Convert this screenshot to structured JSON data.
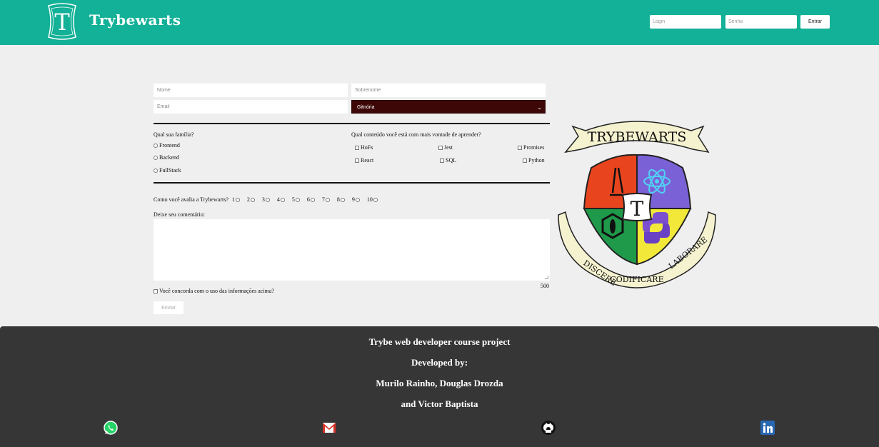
{
  "header": {
    "brand": "Trybewarts",
    "login_placeholder": "Login",
    "password_placeholder": "Senha",
    "login_button": "Entrar",
    "background": "#13b197"
  },
  "form": {
    "name_placeholder": "Nome",
    "lastname_placeholder": "Sobrenome",
    "email_placeholder": "Email",
    "house_selected": "Gitnória",
    "family_question": "Qual sua família?",
    "families": [
      "Frontend",
      "Backend",
      "FullStack"
    ],
    "content_question": "Qual conteúdo você está com mais vontade de aprender?",
    "contents": [
      "HoFs",
      "Jest",
      "Promises",
      "React",
      "SQL",
      "Python"
    ],
    "rating_question": "Como você avalia a Trybewarts?",
    "ratings": [
      "1",
      "2",
      "3",
      "4",
      "5",
      "6",
      "7",
      "8",
      "9",
      "10"
    ],
    "comment_label": "Deixe seu comentário:",
    "char_counter": "500",
    "agreement_label": "Você concorda com o uso das informações acima?",
    "submit_button": "Enviar"
  },
  "crest": {
    "banner_text": "TRYBEWARTS",
    "motto_left": "DISCERE",
    "motto_center": "CODIFICARE",
    "motto_right": "LABORARE",
    "center_letter": "T",
    "colors": {
      "red": "#e8451e",
      "purple": "#7b61d6",
      "green": "#1f9a4a",
      "yellow": "#f2e83a",
      "scroll": "#f5f2d0"
    }
  },
  "footer": {
    "line1": "Trybe web developer course project",
    "line2": "Developed by:",
    "line3": "Murilo Rainho, Douglas Drozda",
    "line4": "and Victor Baptista",
    "socials": [
      "whatsapp-icon",
      "gmail-icon",
      "github-icon",
      "linkedin-icon"
    ]
  }
}
